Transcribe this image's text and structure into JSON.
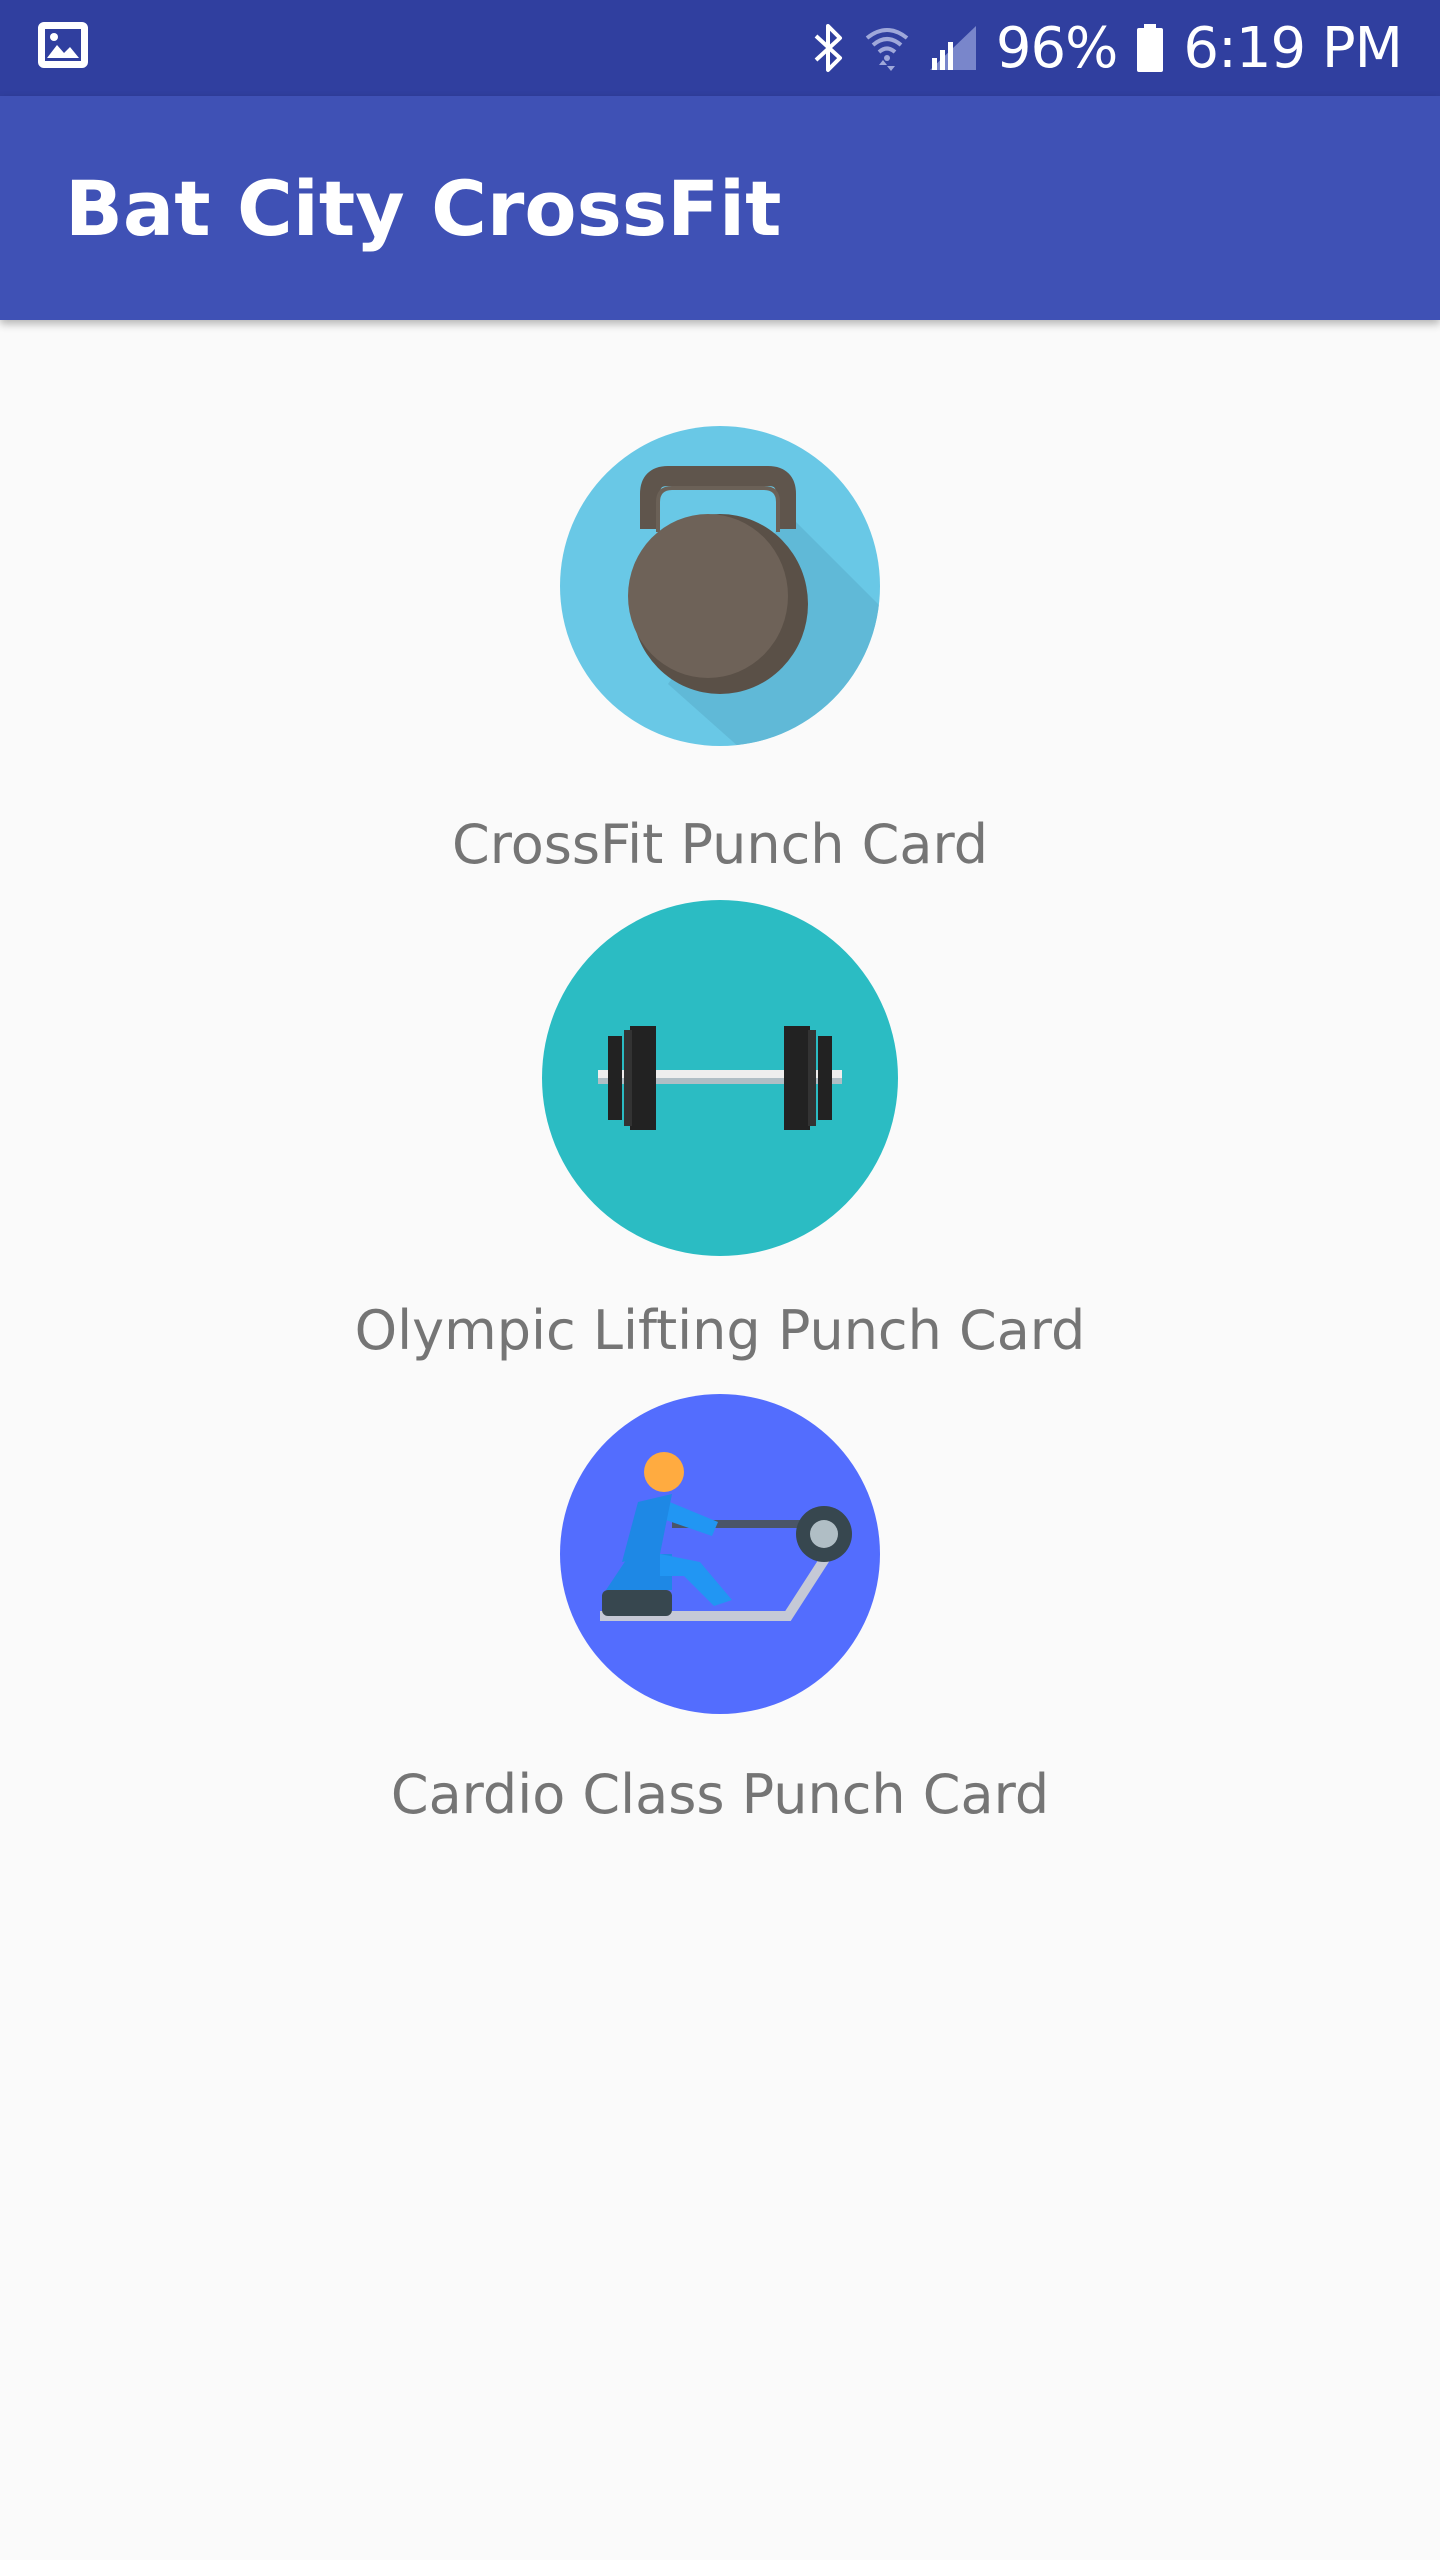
{
  "status_bar": {
    "left_icon": "gallery-notification-icon",
    "icons": [
      "bluetooth-icon",
      "wifi-icon",
      "cell-signal-icon",
      "battery-icon"
    ],
    "battery": "96%",
    "time": "6:19 PM"
  },
  "app_bar": {
    "title": "Bat City CrossFit"
  },
  "cards": [
    {
      "label": "CrossFit Punch Card",
      "icon": "kettlebell-icon"
    },
    {
      "label": "Olympic Lifting Punch Card",
      "icon": "barbell-icon"
    },
    {
      "label": "Cardio Class Punch Card",
      "icon": "rowing-machine-icon"
    }
  ],
  "colors": {
    "status_bar": "#303f9f",
    "app_bar": "#3f51b5",
    "background": "#fafafa",
    "label_text": "#757575",
    "kettlebell_circle": "#69c8e6",
    "barbell_circle": "#2bbcc3",
    "rowing_circle": "#536dfe"
  }
}
